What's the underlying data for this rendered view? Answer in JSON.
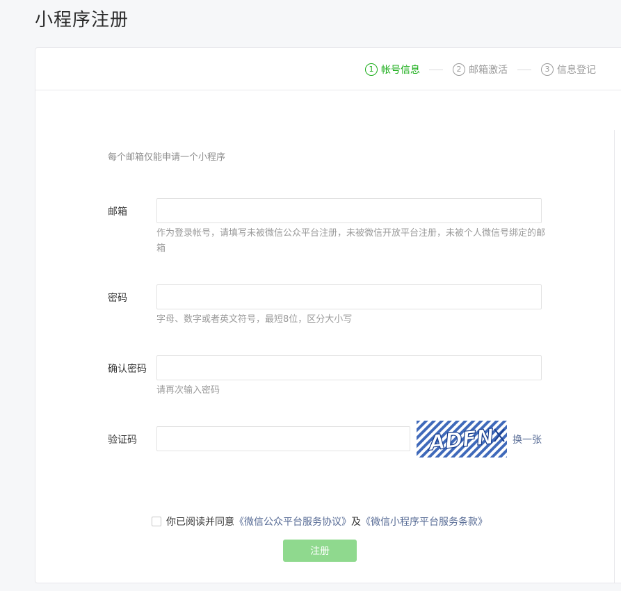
{
  "page": {
    "title": "小程序注册"
  },
  "steps": [
    {
      "num": "1",
      "label": "帐号信息",
      "active": true
    },
    {
      "num": "2",
      "label": "邮箱激活",
      "active": false
    },
    {
      "num": "3",
      "label": "信息登记",
      "active": false
    }
  ],
  "form": {
    "tip": "每个邮箱仅能申请一个小程序",
    "email": {
      "label": "邮箱",
      "value": "",
      "hint": "作为登录帐号，请填写未被微信公众平台注册，未被微信开放平台注册，未被个人微信号绑定的邮箱"
    },
    "password": {
      "label": "密码",
      "value": "",
      "hint": "字母、数字或者英文符号，最短8位，区分大小写"
    },
    "confirm_password": {
      "label": "确认密码",
      "value": "",
      "hint": "请再次输入密码"
    },
    "captcha": {
      "label": "验证码",
      "value": "",
      "image_text": "ADFN",
      "refresh_label": "换一张"
    },
    "agreement": {
      "prefix": "你已阅读并同意",
      "link1": "《微信公众平台服务协议》",
      "conjunction": "及",
      "link2": "《微信小程序平台服务条款》",
      "checked": false
    },
    "submit_label": "注册"
  },
  "colors": {
    "accent": "#1aad19",
    "link": "#576b95",
    "button_disabled": "#8fd98e"
  }
}
